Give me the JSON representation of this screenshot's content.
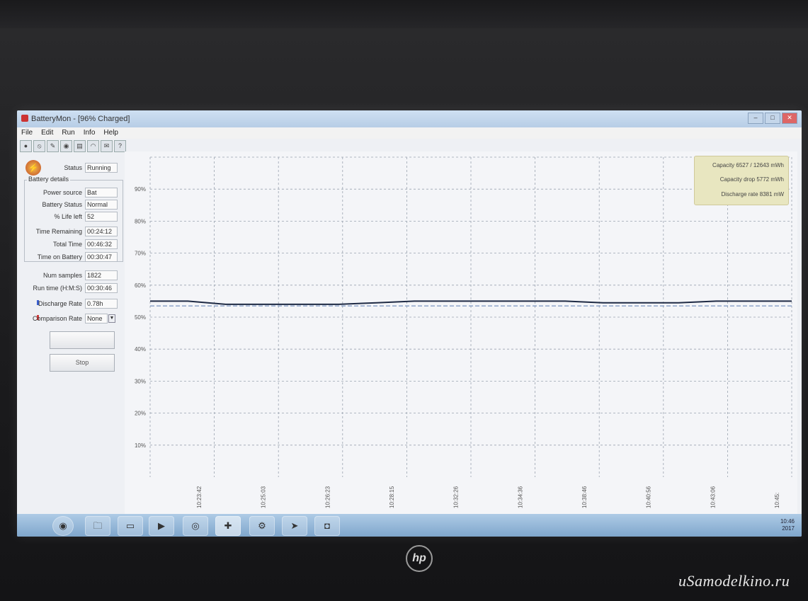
{
  "window": {
    "title": "BatteryMon - [96% Charged]",
    "controls": [
      "–",
      "□",
      "✕"
    ]
  },
  "menu": [
    "File",
    "Edit",
    "Run",
    "Info",
    "Help"
  ],
  "toolbar_icons": [
    "play-icon",
    "stop-icon",
    "settings-icon",
    "refresh-icon",
    "save-icon",
    "info-icon",
    "help-icon",
    "exit-icon"
  ],
  "toolbar_glyphs": [
    "●",
    "⦸",
    "✎",
    "◉",
    "▤",
    "◠",
    "✉",
    "?"
  ],
  "panel": {
    "status_label": "Status",
    "status_value": "Running",
    "battery_details_title": "Battery details",
    "power_source_label": "Power source",
    "power_source_value": "Bat",
    "battery_status_label": "Battery Status",
    "battery_status_value": "Normal",
    "life_left_label": "% Life left",
    "life_left_value": "52",
    "time_remaining_label": "Time Remaining",
    "time_remaining_value": "00:24:12",
    "total_time_label": "Total Time",
    "total_time_value": "00:46:32",
    "time_on_battery_label": "Time on Battery",
    "time_on_battery_value": "00:30:47",
    "num_samples_label": "Num samples",
    "num_samples_value": "1822",
    "run_time_label": "Run time (H:M:S)",
    "run_time_value": "00:30:46",
    "discharge_rate_label": "Discharge Rate",
    "discharge_rate_value": "0.78h",
    "comparison_rate_label": "Comparison Rate",
    "comparison_rate_value": "None",
    "start_button": "",
    "stop_button": "Stop",
    "marker_colors": {
      "discharge": "#3a5fd0",
      "comparison": "#d03a3a"
    }
  },
  "legend": {
    "capacity": "Capacity 6527 / 12643 mWh",
    "capacity_drop": "Capacity drop 5772 mWh",
    "discharge_rate": "Discharge rate 8381 mW"
  },
  "chart_data": {
    "type": "line",
    "ytick_labels": [
      "90%",
      "80%",
      "70%",
      "60%",
      "50%",
      "40%",
      "30%",
      "20%",
      "10%"
    ],
    "xtick_labels": [
      "10:23:42",
      "10:25:03",
      "10:26:23",
      "10:28:15",
      "10:32:26",
      "10:34:36",
      "10:38:46",
      "10:40:56",
      "10:43:06",
      "10:45:"
    ],
    "series": [
      {
        "values": [
          55,
          55,
          54,
          54,
          54,
          54,
          54.5,
          55,
          55,
          55,
          55,
          55,
          54.5,
          54.5,
          54.5,
          55,
          55,
          55
        ]
      }
    ],
    "comparison_line": 53.5,
    "ylim": [
      0,
      100
    ],
    "grid": true,
    "legend": "top-right",
    "line_color": "#1e2a44",
    "dash_color": "#5d7fb5"
  },
  "taskbar": {
    "items": [
      "start-orb-icon",
      "explorer-icon",
      "folder-icon",
      "media-icon",
      "chrome-icon",
      "battery-app-icon",
      "antivirus-icon",
      "telegram-icon",
      "pinned-app-icon"
    ],
    "glyphs": [
      "◉",
      "🗀",
      "▭",
      "▶",
      "◎",
      "✚",
      "⚙",
      "➤",
      "◘"
    ],
    "clock_time": "10:46",
    "clock_date": "2017"
  },
  "branding": {
    "laptop_logo": "hp",
    "watermark": "uSamodelkino.ru"
  }
}
